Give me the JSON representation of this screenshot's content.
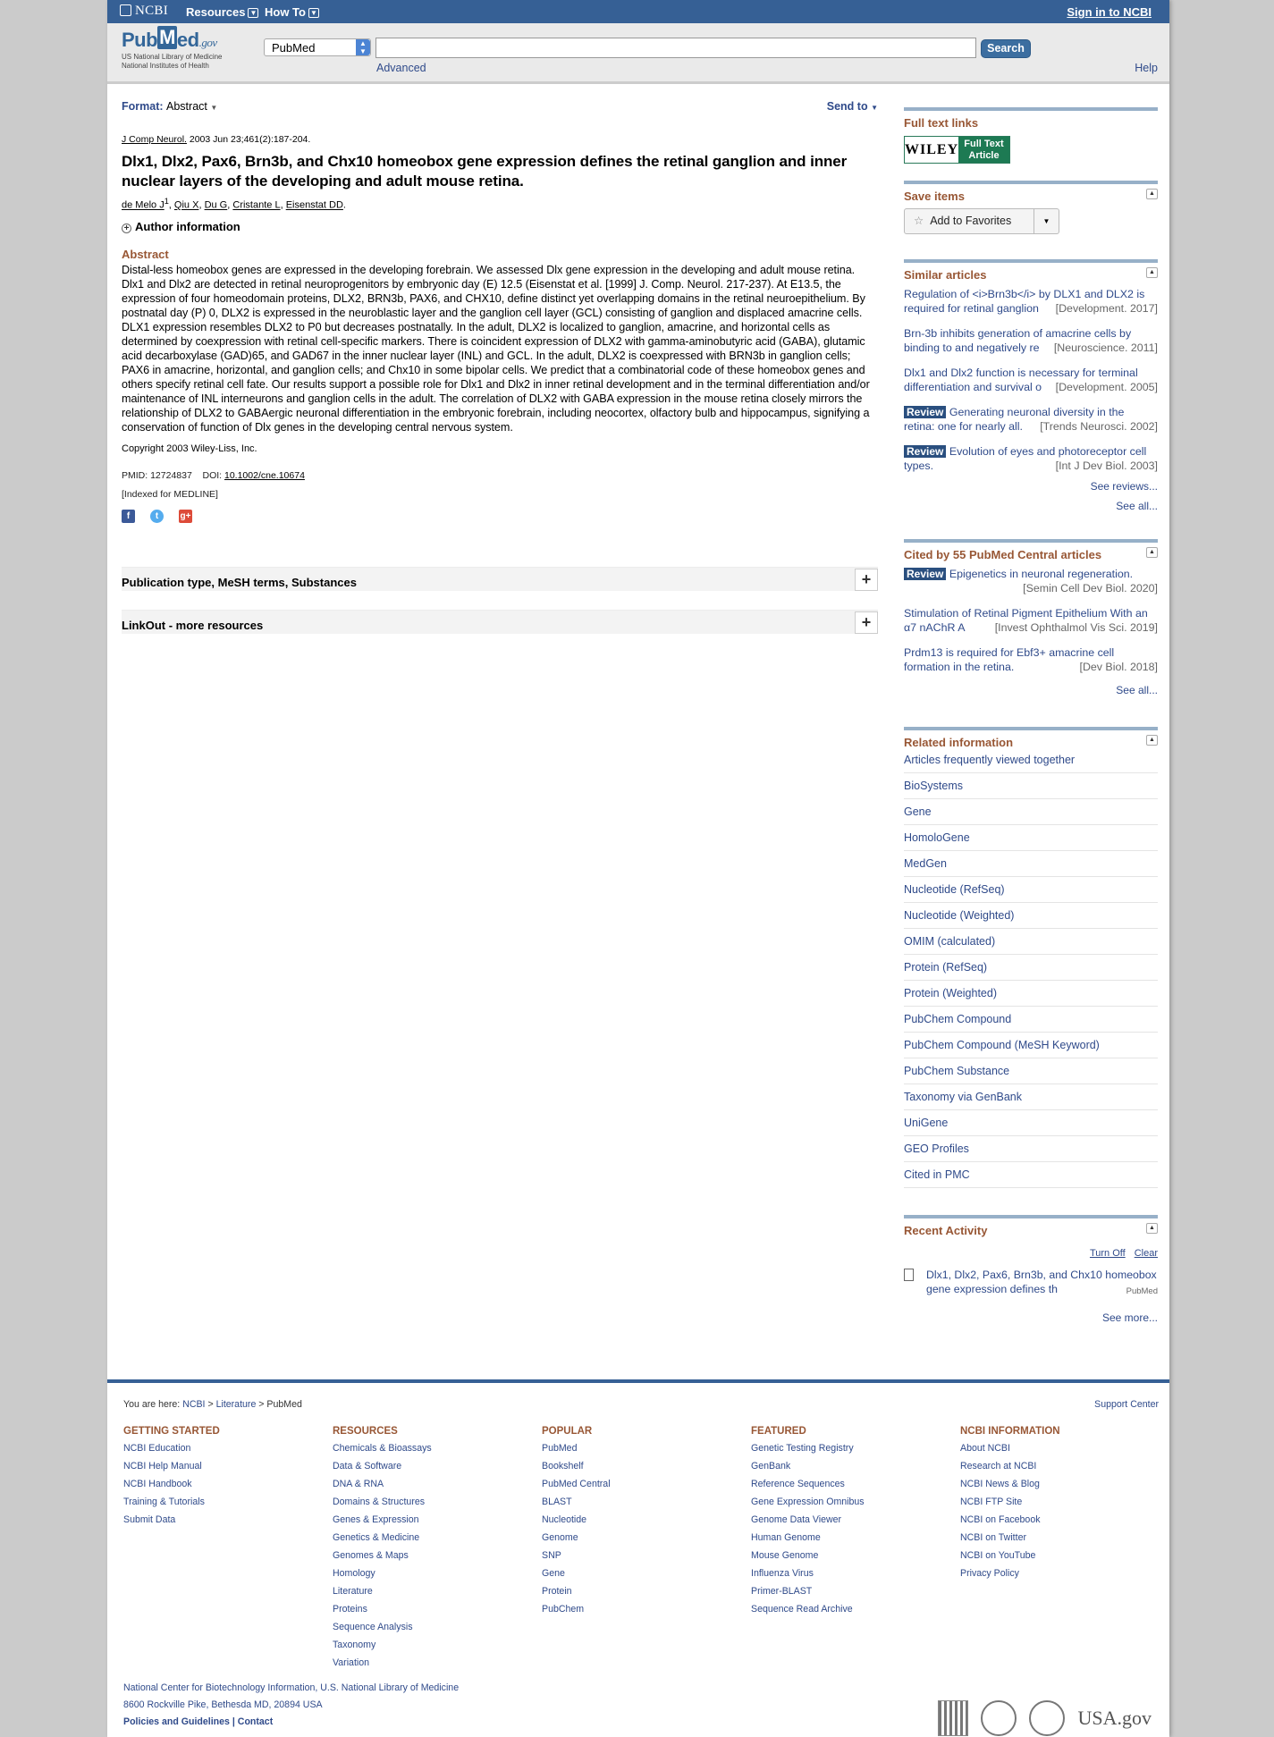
{
  "topbar": {
    "brand": "NCBI",
    "resources": "Resources",
    "howto": "How To",
    "signin": "Sign in to NCBI"
  },
  "search": {
    "logo_pub": "Pub",
    "logo_m": "M",
    "logo_ed": "ed",
    "logo_gov": ".gov",
    "logo_line1": "US National Library of Medicine",
    "logo_line2": "National Institutes of Health",
    "db": "PubMed",
    "button": "Search",
    "advanced": "Advanced",
    "help": "Help"
  },
  "article": {
    "format_label": "Format",
    "format_value": "Abstract",
    "send_to": "Send to",
    "journal": "J Comp Neurol.",
    "citation": "2003 Jun 23;461(2):187-204.",
    "title": "Dlx1, Dlx2, Pax6, Brn3b, and Chx10 homeobox gene expression defines the retinal ganglion and inner nuclear layers of the developing and adult mouse retina.",
    "authors": [
      "de Melo J",
      "Qiu X",
      "Du G",
      "Cristante L",
      "Eisenstat DD"
    ],
    "first_author_sup": "1",
    "author_info": "Author information",
    "abstract_heading": "Abstract",
    "abstract": "Distal-less homeobox genes are expressed in the developing forebrain. We assessed Dlx gene expression in the developing and adult mouse retina. Dlx1 and Dlx2 are detected in retinal neuroprogenitors by embryonic day (E) 12.5 (Eisenstat et al. [1999] J. Comp. Neurol. 217-237). At E13.5, the expression of four homeodomain proteins, DLX2, BRN3b, PAX6, and CHX10, define distinct yet overlapping domains in the retinal neuroepithelium. By postnatal day (P) 0, DLX2 is expressed in the neuroblastic layer and the ganglion cell layer (GCL) consisting of ganglion and displaced amacrine cells. DLX1 expression resembles DLX2 to P0 but decreases postnatally. In the adult, DLX2 is localized to ganglion, amacrine, and horizontal cells as determined by coexpression with retinal cell-specific markers. There is coincident expression of DLX2 with gamma-aminobutyric acid (GABA), glutamic acid decarboxylase (GAD)65, and GAD67 in the inner nuclear layer (INL) and GCL. In the adult, DLX2 is coexpressed with BRN3b in ganglion cells; PAX6 in amacrine, horizontal, and ganglion cells; and Chx10 in some bipolar cells. We predict that a combinatorial code of these homeobox genes and others specify retinal cell fate. Our results support a possible role for Dlx1 and Dlx2 in inner retinal development and in the terminal differentiation and/or maintenance of INL interneurons and ganglion cells in the adult. The correlation of DLX2 with GABA expression in the mouse retina closely mirrors the relationship of DLX2 to GABAergic neuronal differentiation in the embryonic forebrain, including neocortex, olfactory bulb and hippocampus, signifying a conservation of function of Dlx genes in the developing central nervous system.",
    "copyright": "Copyright 2003 Wiley-Liss, Inc.",
    "pmid": "PMID: 12724837",
    "doi_label": "DOI:",
    "doi": "10.1002/cne.10674",
    "indexed": "[Indexed for MEDLINE]",
    "sections": [
      "Publication type, MeSH terms, Substances",
      "LinkOut - more resources"
    ]
  },
  "sidebar": {
    "fulltext_heading": "Full text links",
    "wiley": "WILEY",
    "wiley_ft1": "Full Text",
    "wiley_ft2": "Article",
    "save_heading": "Save items",
    "add_fav": "Add to Favorites",
    "similar_heading": "Similar articles",
    "similar": [
      {
        "review": "",
        "text": "Regulation of <i>Brn3b</i> by DLX1 and DLX2 is required for retinal ganglion",
        "src": "[Development. 2017]"
      },
      {
        "review": "",
        "text": "Brn-3b inhibits generation of amacrine cells by binding to and negatively re",
        "src": "[Neuroscience. 2011]"
      },
      {
        "review": "",
        "text": "Dlx1 and Dlx2 function is necessary for terminal differentiation and survival o",
        "src": "[Development. 2005]"
      },
      {
        "review": "Review",
        "text": "Generating neuronal diversity in the retina: one for nearly all.",
        "src": "[Trends Neurosci. 2002]"
      },
      {
        "review": "Review",
        "text": "Evolution of eyes and photoreceptor cell types.",
        "src": "[Int J Dev Biol. 2003]"
      }
    ],
    "see_reviews": "See reviews...",
    "see_all": "See all...",
    "cited_heading": "Cited by 55 PubMed Central articles",
    "cited": [
      {
        "review": "Review",
        "text": "Epigenetics in neuronal regeneration.",
        "src": "[Semin Cell Dev Biol. 2020]"
      },
      {
        "review": "",
        "text": "Stimulation of Retinal Pigment Epithelium With an α7 nAChR A",
        "src": "[Invest Ophthalmol Vis Sci. 2019]"
      },
      {
        "review": "",
        "text": "Prdm13 is required for Ebf3+ amacrine cell formation in the retina.",
        "src": "[Dev Biol. 2018]"
      }
    ],
    "cited_see_all": "See all...",
    "related_heading": "Related information",
    "related": [
      "Articles frequently viewed together",
      "BioSystems",
      "Gene",
      "HomoloGene",
      "MedGen",
      "Nucleotide (RefSeq)",
      "Nucleotide (Weighted)",
      "OMIM (calculated)",
      "Protein (RefSeq)",
      "Protein (Weighted)",
      "PubChem Compound",
      "PubChem Compound (MeSH Keyword)",
      "PubChem Substance",
      "Taxonomy via GenBank",
      "UniGene",
      "GEO Profiles",
      "Cited in PMC"
    ],
    "recent_heading": "Recent Activity",
    "turn_off": "Turn Off",
    "clear": "Clear",
    "recent_item": "Dlx1, Dlx2, Pax6, Brn3b, and Chx10 homeobox gene expression defines th",
    "recent_src": "PubMed",
    "see_more": "See more..."
  },
  "footer": {
    "here_label": "You are here:",
    "crumbs": [
      "NCBI",
      "Literature",
      "PubMed"
    ],
    "support": "Support Center",
    "cols": [
      {
        "title": "GETTING STARTED",
        "links": [
          "NCBI Education",
          "NCBI Help Manual",
          "NCBI Handbook",
          "Training & Tutorials",
          "Submit Data"
        ]
      },
      {
        "title": "RESOURCES",
        "links": [
          "Chemicals & Bioassays",
          "Data & Software",
          "DNA & RNA",
          "Domains & Structures",
          "Genes & Expression",
          "Genetics & Medicine",
          "Genomes & Maps",
          "Homology",
          "Literature",
          "Proteins",
          "Sequence Analysis",
          "Taxonomy",
          "Variation"
        ]
      },
      {
        "title": "POPULAR",
        "links": [
          "PubMed",
          "Bookshelf",
          "PubMed Central",
          "BLAST",
          "Nucleotide",
          "Genome",
          "SNP",
          "Gene",
          "Protein",
          "PubChem"
        ]
      },
      {
        "title": "FEATURED",
        "links": [
          "Genetic Testing Registry",
          "GenBank",
          "Reference Sequences",
          "Gene Expression Omnibus",
          "Genome Data Viewer",
          "Human Genome",
          "Mouse Genome",
          "Influenza Virus",
          "Primer-BLAST",
          "Sequence Read Archive"
        ]
      },
      {
        "title": "NCBI INFORMATION",
        "links": [
          "About NCBI",
          "Research at NCBI",
          "NCBI News & Blog",
          "NCBI FTP Site",
          "NCBI on Facebook",
          "NCBI on Twitter",
          "NCBI on YouTube",
          "Privacy Policy"
        ]
      }
    ],
    "addr1": "National Center for Biotechnology Information, U.S. National Library of Medicine",
    "addr2": "8600 Rockville Pike, Bethesda MD, 20894 USA",
    "policies": "Policies and Guidelines",
    "contact": "Contact",
    "usa": "USA.gov"
  }
}
